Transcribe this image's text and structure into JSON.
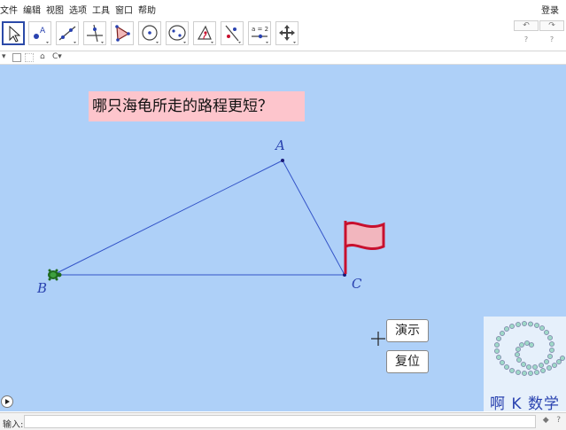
{
  "menu": {
    "items": [
      "文件",
      "编辑",
      "视图",
      "选项",
      "工具",
      "窗口",
      "帮助"
    ],
    "login": "登录"
  },
  "toolbar": {
    "tools": [
      {
        "name": "move-tool-icon",
        "active": true
      },
      {
        "name": "point-tool-icon",
        "label": "A"
      },
      {
        "name": "line-tool-icon"
      },
      {
        "name": "perpendicular-tool-icon"
      },
      {
        "name": "polygon-tool-icon"
      },
      {
        "name": "circle-tool-icon"
      },
      {
        "name": "ellipse-tool-icon"
      },
      {
        "name": "angle-tool-icon"
      },
      {
        "name": "reflect-tool-icon"
      },
      {
        "name": "slider-tool-icon",
        "label": "a = 2"
      },
      {
        "name": "move-view-tool-icon"
      }
    ],
    "undo": "↶",
    "redo": "↷",
    "help": "?"
  },
  "canvas": {
    "background": "#aed0f8",
    "question": "哪只海龟所走的路程更短？",
    "vertices": {
      "A": "A",
      "B": "B",
      "C": "C"
    },
    "buttons": {
      "demo": "演示",
      "reset": "复位"
    },
    "logo": "啊 K 数学",
    "line_color": "#3454c8",
    "flag_color": "#c8102e"
  },
  "inputbar": {
    "label": "输入:",
    "placeholder": "",
    "icons": [
      "◆",
      "?"
    ]
  }
}
